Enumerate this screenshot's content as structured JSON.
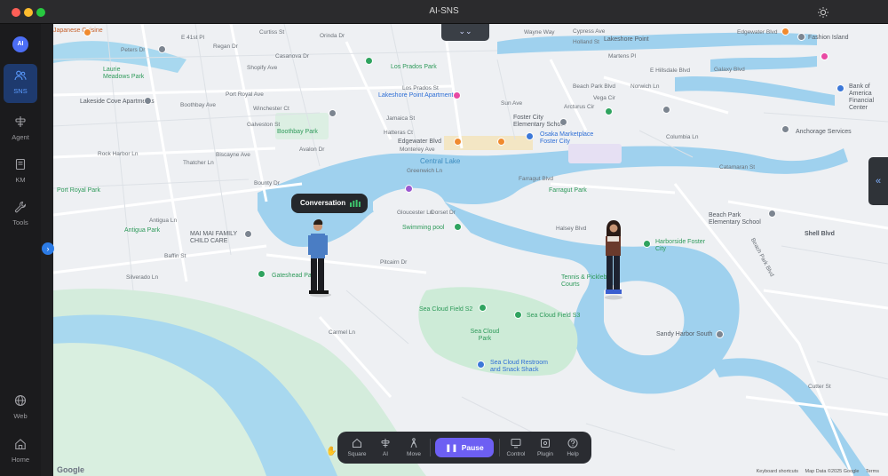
{
  "window": {
    "title": "AI-SNS"
  },
  "sidebar": {
    "avatar": "AI",
    "items": [
      {
        "label": "SNS",
        "icon": "users-icon"
      },
      {
        "label": "Agent",
        "icon": "agent-icon"
      },
      {
        "label": "KM",
        "icon": "book-icon"
      },
      {
        "label": "Tools",
        "icon": "wrench-icon"
      },
      {
        "label": "Web",
        "icon": "globe-icon"
      },
      {
        "label": "Home",
        "icon": "home-icon"
      }
    ]
  },
  "map": {
    "conversation_label": "Conversation",
    "google_logo": "Google",
    "attribution": {
      "shortcuts": "Keyboard shortcuts",
      "data": "Map Data ©2025 Google",
      "terms": "Terms"
    },
    "places": [
      "Japanese Cuisine",
      "E 41st Pl",
      "Curtiss St",
      "Orinda Dr",
      "Wayne Way",
      "Cypress Ave",
      "Edgewater Blvd",
      "Holland St",
      "Lakeshore Point",
      "Martens Pl",
      "E Hillsdale Blvd",
      "Port Royal Ave",
      "Beach Park Blvd",
      "Vega Cir",
      "Arcturus Cir",
      "Norwich Ln",
      "Jamaica St",
      "Los Prados Park",
      "Los Prados St",
      "Casanova Dr",
      "Boothbay Park",
      "Boothbay Ave",
      "Winchester Ct",
      "Galveston St",
      "Sun Ave",
      "Foster City Elementary School",
      "Osaka Marketplace Foster City",
      "Hatteras Ct",
      "Edgewater Blvd",
      "Monterey Ave",
      "Central Lake",
      "Biscayne Ave",
      "Avalon Dr",
      "Rock Harbor Ln",
      "Thatcher Ln",
      "Bounty Dr",
      "Port Royal Park",
      "Greenwich Ln",
      "Farragut Blvd",
      "Farragut Park",
      "Beach Park Elementary School",
      "Shell Blvd",
      "Antigua Ln",
      "Antigua Park",
      "MAI MAI FAMILY CHILD CARE",
      "Swimming pool",
      "Gloucester Ln",
      "Dorset Dr",
      "Halsey Blvd",
      "Harborside Foster City",
      "Baffin St",
      "Silverado Ln",
      "Gateshead Park",
      "Pitcairn Dr",
      "Tennis & Pickleball Courts",
      "Sea Cloud Field S2",
      "Sea Cloud Field S3",
      "Sea Cloud Park",
      "Sea Cloud Restroom and Snack Shack",
      "Beach Park Blvd",
      "Sandy Harbor South",
      "Carmel Ln",
      "Cutter St",
      "Anchorage Services",
      "Galaxy Blvd",
      "Fashion Island",
      "Bank of America Financial Center",
      "Peters Dr",
      "Regan Dr",
      "Shopify Ave",
      "Laurie Meadows Park",
      "Lakeside Cove Apartments",
      "Lakeshore Point Apartments",
      "Catamaran St",
      "Columbia Ln"
    ]
  },
  "toolbar": {
    "square": "Square",
    "ai": "AI",
    "move": "Move",
    "pause": "Pause",
    "control": "Control",
    "plugin": "Plugin",
    "help": "Help"
  },
  "colors": {
    "accent": "#6d5ff3",
    "sidebar_active": "#1e3a6e",
    "water": "#9fd1ee",
    "park": "#cdebd7"
  }
}
